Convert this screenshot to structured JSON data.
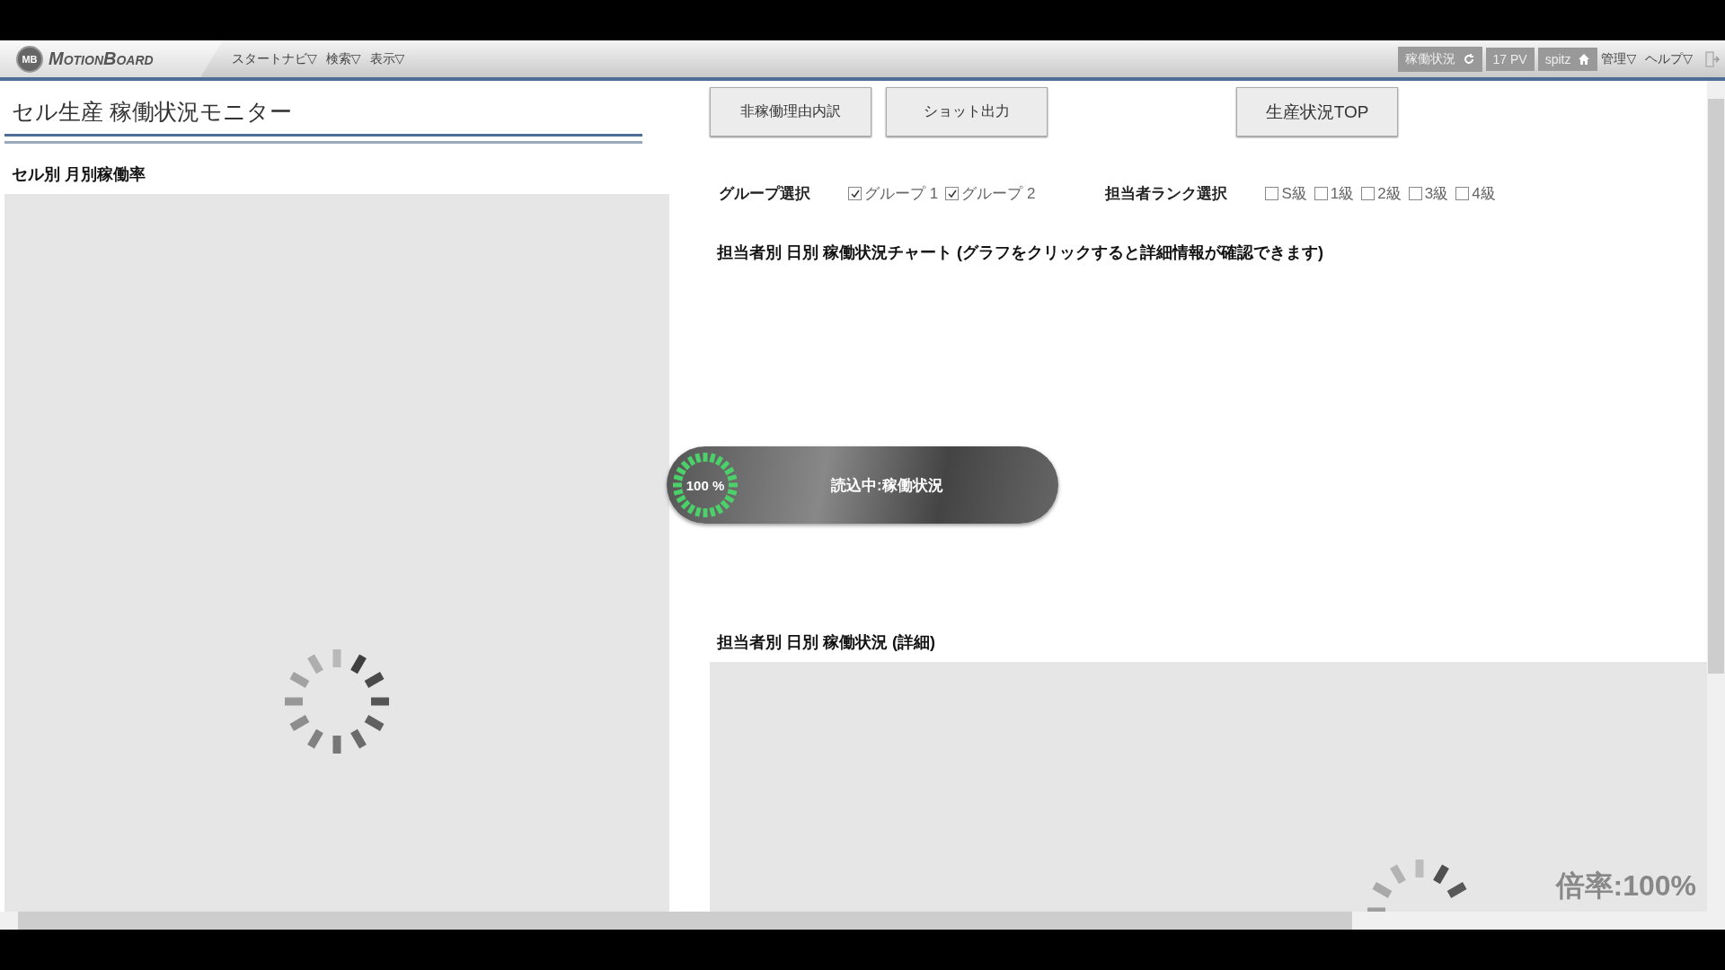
{
  "app_bar": {
    "logo_badge": "MB",
    "logo": "MotionBoard",
    "menus": [
      {
        "label": "スタートナビ▽"
      },
      {
        "label": "検索▽"
      },
      {
        "label": "表示▽"
      }
    ],
    "status": "稼働状況",
    "page_views": "17 PV",
    "user": "spitz",
    "right_menus": [
      {
        "label": "管理▽"
      },
      {
        "label": "ヘルプ▽"
      }
    ]
  },
  "page": {
    "title": "セル生産 稼働状況モニター",
    "buttons": [
      {
        "label": "非稼働理由内訳"
      },
      {
        "label": "ショット出力"
      },
      {
        "label": "生産状況TOP"
      }
    ],
    "left_heading": "セル別 月別稼働率",
    "group_label": "グループ選択",
    "groups": [
      {
        "label": "グループ 1",
        "checked": true
      },
      {
        "label": "グループ 2",
        "checked": true
      }
    ],
    "rank_label": "担当者ランク選択",
    "ranks": [
      {
        "label": "S級",
        "checked": false
      },
      {
        "label": "1級",
        "checked": false
      },
      {
        "label": "2級",
        "checked": false
      },
      {
        "label": "3級",
        "checked": false
      },
      {
        "label": "4級",
        "checked": false
      }
    ],
    "chart_heading": "担当者別 日別 稼働状況チャート (グラフをクリックすると詳細情報が確認できます)",
    "detail_heading": "担当者別 日別 稼働状況 (詳細)",
    "zoom": "倍率:100%"
  },
  "loading": {
    "percent": "100 %",
    "message": "読込中:稼働状況"
  }
}
